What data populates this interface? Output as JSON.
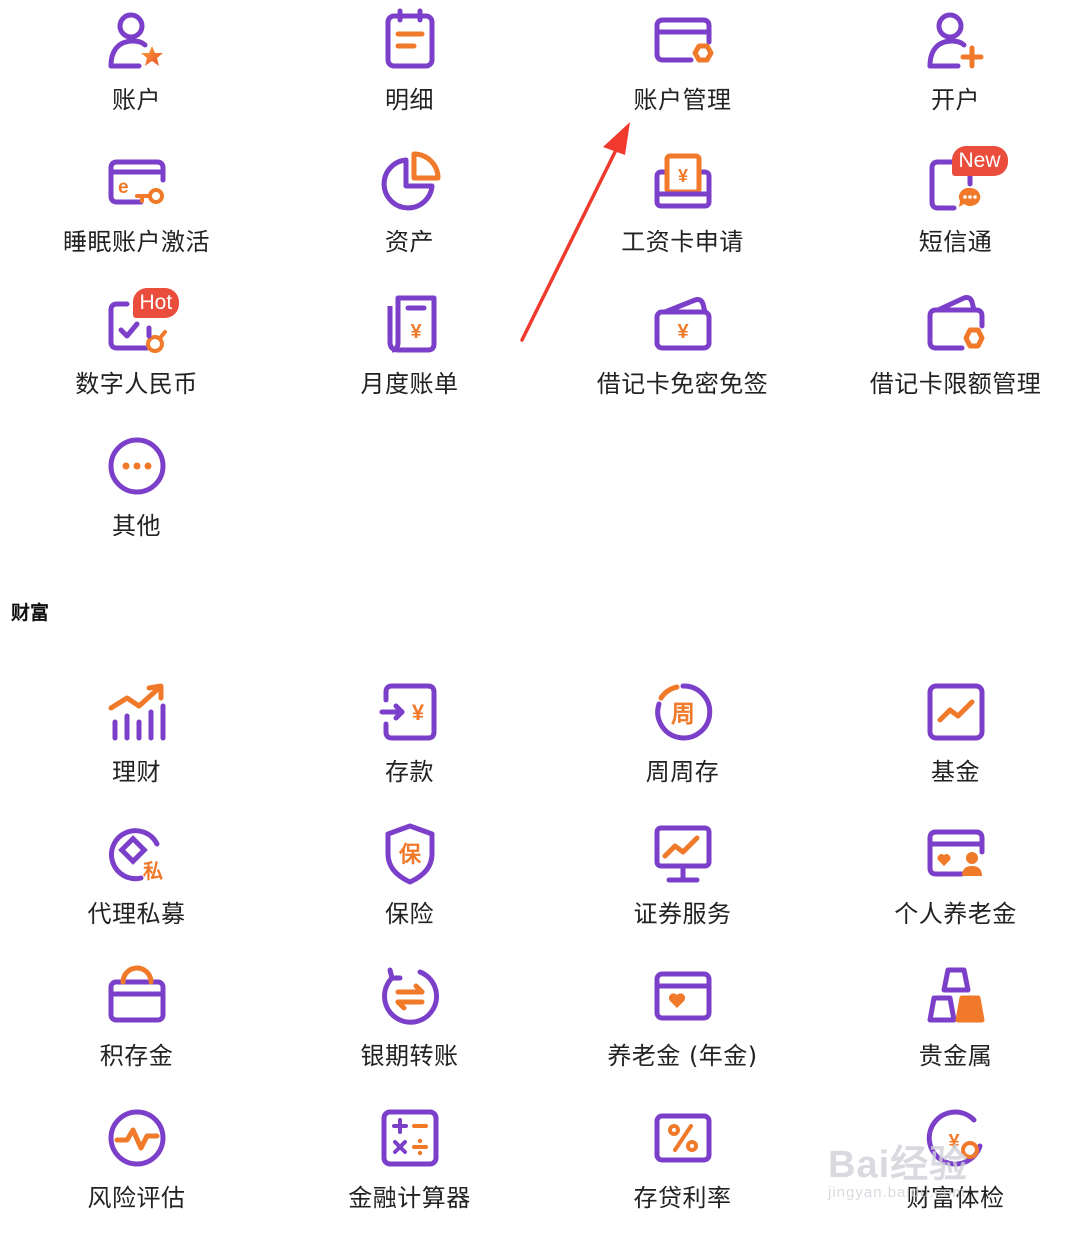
{
  "account_section": {
    "items": [
      {
        "label": "账户"
      },
      {
        "label": "明细"
      },
      {
        "label": "账户管理"
      },
      {
        "label": "开户"
      },
      {
        "label": "睡眠账户激活"
      },
      {
        "label": "资产"
      },
      {
        "label": "工资卡申请"
      },
      {
        "label": "短信通",
        "badge": "New"
      },
      {
        "label": "数字人民币",
        "badge": "Hot"
      },
      {
        "label": "月度账单"
      },
      {
        "label": "借记卡免密免签"
      },
      {
        "label": "借记卡限额管理"
      },
      {
        "label": "其他"
      }
    ]
  },
  "wealth_section": {
    "title": "财富",
    "items": [
      {
        "label": "理财"
      },
      {
        "label": "存款"
      },
      {
        "label": "周周存",
        "icon_text": "周"
      },
      {
        "label": "基金"
      },
      {
        "label": "代理私募",
        "icon_text": "私"
      },
      {
        "label": "保险",
        "icon_text": "保"
      },
      {
        "label": "证券服务"
      },
      {
        "label": "个人养老金"
      },
      {
        "label": "积存金"
      },
      {
        "label": "银期转账"
      },
      {
        "label": "养老金 (年金)"
      },
      {
        "label": "贵金属"
      },
      {
        "label": "风险评估"
      },
      {
        "label": "金融计算器"
      },
      {
        "label": "存贷利率"
      },
      {
        "label": "财富体检"
      }
    ]
  },
  "icon_glyphs": {
    "yuan": "¥"
  },
  "watermark": {
    "main": "Bai经验",
    "sub": "jingyan.baidu.com"
  },
  "colors": {
    "purple": "#7b3fc9",
    "orange": "#f07a2a",
    "badge": "#ea4d3c",
    "arrow": "#f03a2e"
  }
}
